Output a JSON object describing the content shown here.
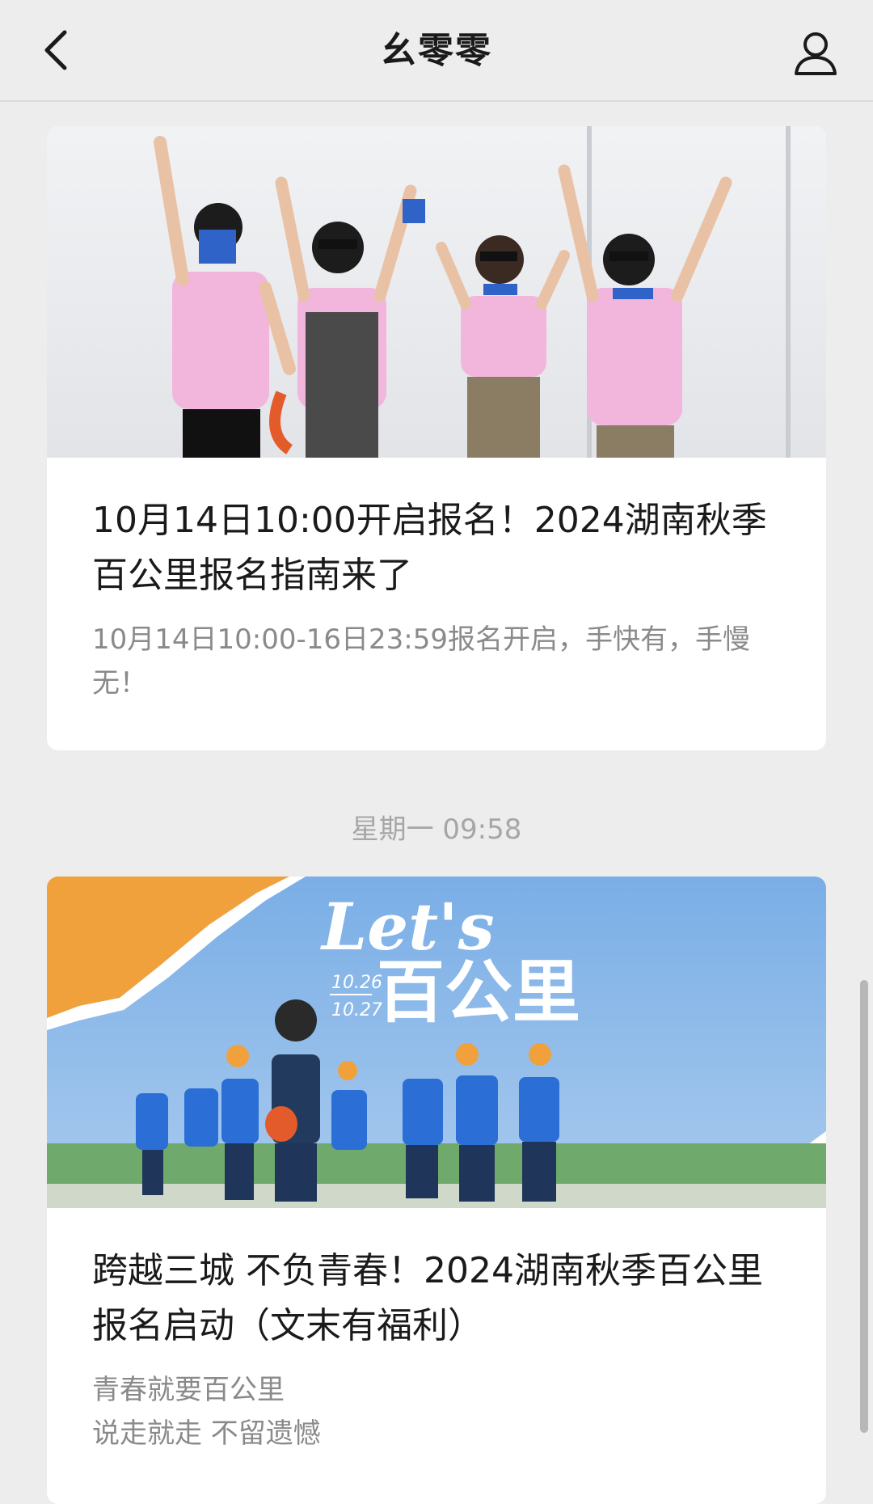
{
  "header": {
    "title": "幺零零",
    "back_icon": "chevron-left-icon",
    "profile_icon": "person-icon"
  },
  "articles": [
    {
      "cover_alt": "cover-photo-group-jumping",
      "title": "10月14日10:00开启报名！2024湖南秋季百公里报名指南来了",
      "description": "10月14日10:00-16日23:59报名开启，手快有，手慢无！"
    },
    {
      "cover_alt": "cover-photo-hikers",
      "cover_heading": "Let's",
      "cover_subheading": "百公里",
      "cover_date_1": "10.26",
      "cover_date_2": "10.27",
      "title": "跨越三城 不负青春！2024湖南秋季百公里报名启动（文末有福利）",
      "description": "青春就要百公里\n说走就走 不留遗憾"
    }
  ],
  "timestamp": "星期一 09:58",
  "colors": {
    "background": "#ededed",
    "card": "#ffffff",
    "accent_orange": "#f0a13c",
    "sky_blue": "#7fb1e6"
  }
}
